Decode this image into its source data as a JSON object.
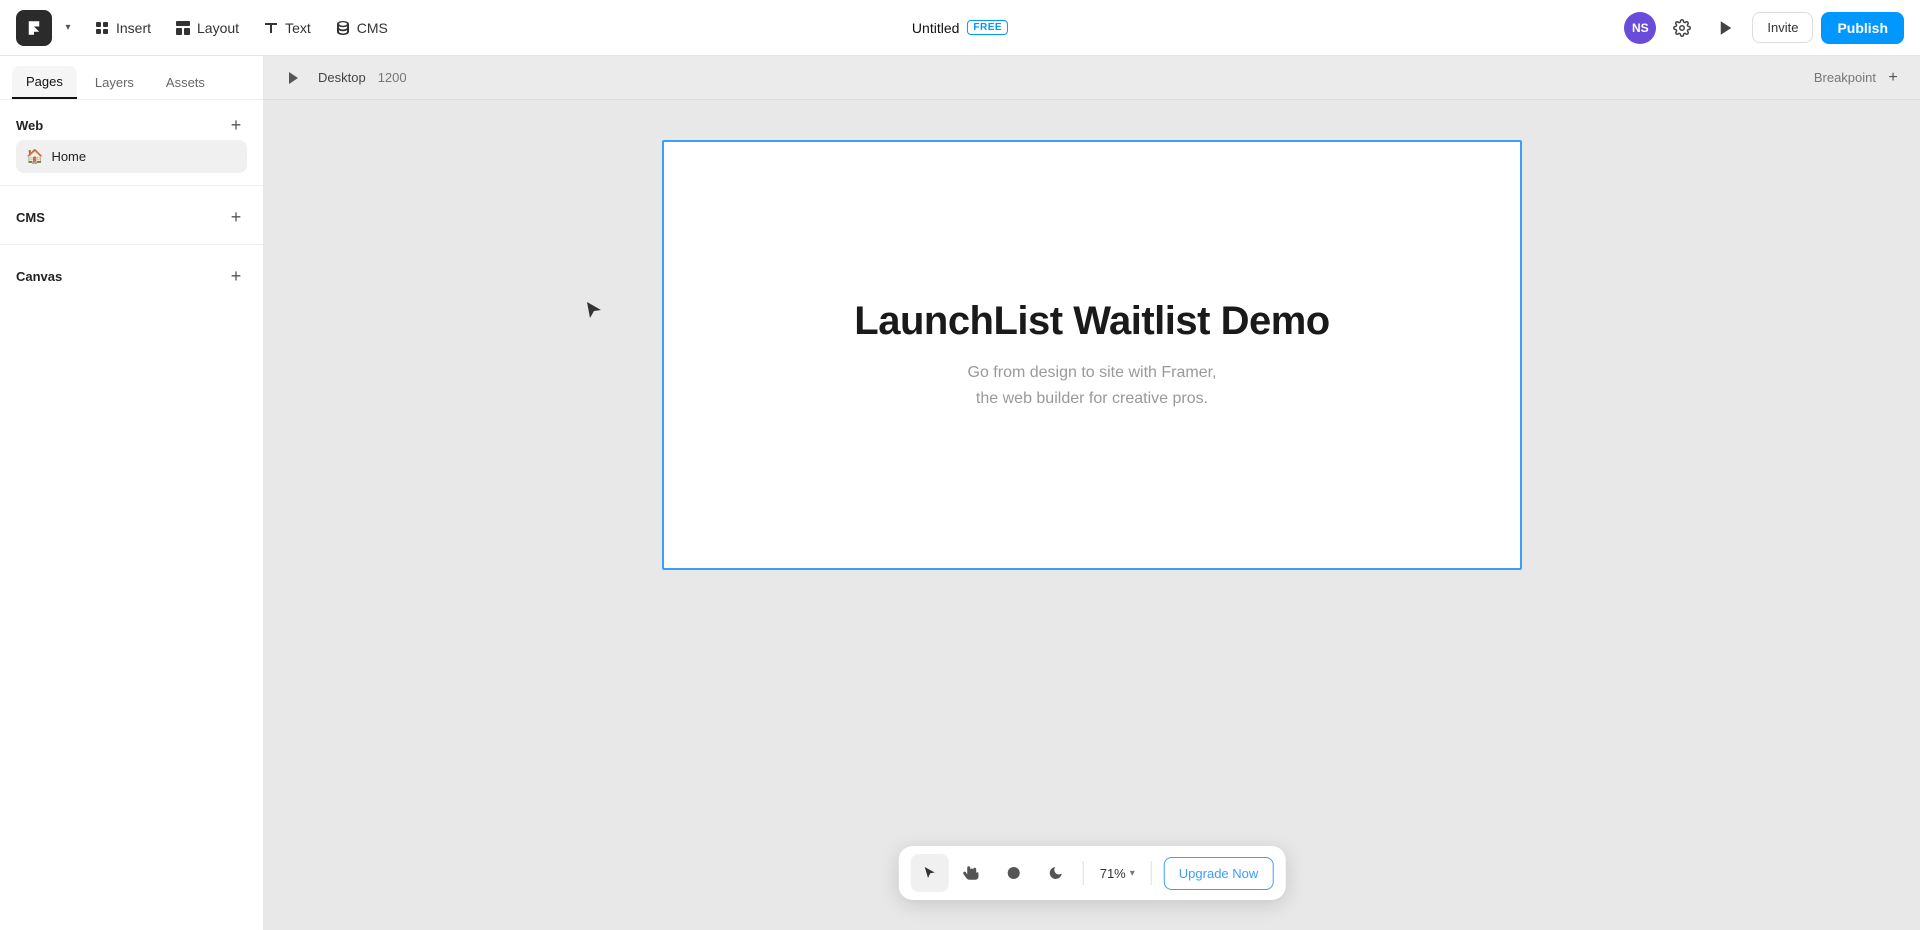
{
  "topnav": {
    "logo_label": "F",
    "insert_label": "Insert",
    "layout_label": "Layout",
    "text_label": "Text",
    "cms_label": "CMS",
    "title": "Untitled",
    "free_badge": "FREE",
    "settings_tooltip": "Settings",
    "preview_tooltip": "Preview",
    "invite_label": "Invite",
    "publish_label": "Publish",
    "avatar_initials": "NS"
  },
  "sidebar": {
    "tab_pages": "Pages",
    "tab_layers": "Layers",
    "tab_assets": "Assets",
    "section_web": "Web",
    "section_cms": "CMS",
    "section_canvas": "Canvas",
    "home_page": "Home"
  },
  "canvas": {
    "desktop_label": "Desktop",
    "width_label": "1200",
    "breakpoint_label": "Breakpoint",
    "frame_title": "LaunchList Waitlist Demo",
    "frame_subtitle_line1": "Go from design to site with Framer,",
    "frame_subtitle_line2": "the web builder for creative pros."
  },
  "toolbar": {
    "select_tool": "▲",
    "hand_tool": "✋",
    "circle_tool": "●",
    "dark_tool": "🌙",
    "zoom_value": "71%",
    "upgrade_label": "Upgrade Now"
  }
}
